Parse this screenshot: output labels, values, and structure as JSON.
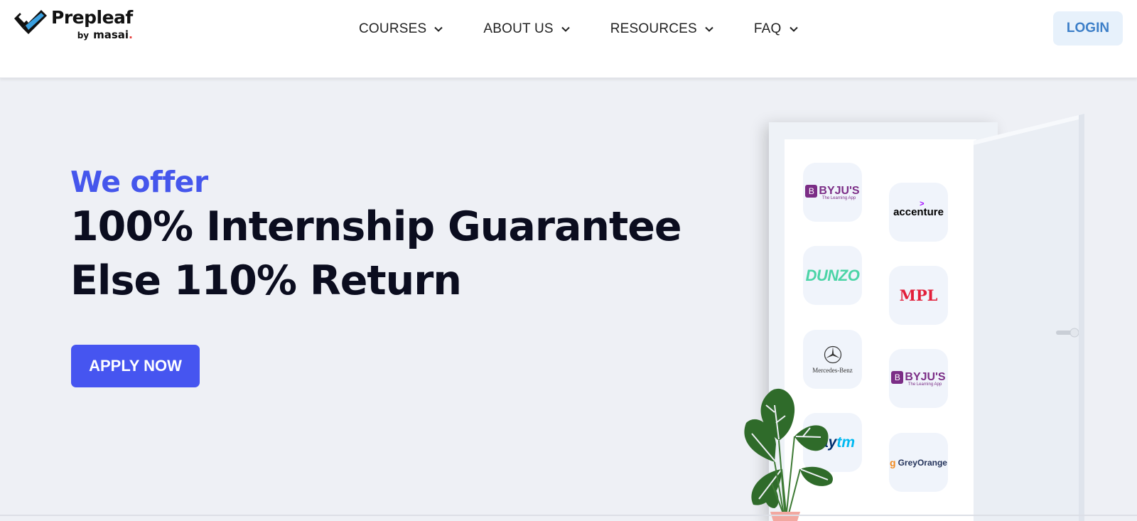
{
  "brand": {
    "name": "Prepleaf",
    "by": "by",
    "parent": "masai",
    "parent_dot": "."
  },
  "nav": {
    "items": [
      {
        "label": "COURSES",
        "icon": "chevron-down-icon"
      },
      {
        "label": "ABOUT US",
        "icon": "chevron-down-icon"
      },
      {
        "label": "RESOURCES",
        "icon": "chevron-down-icon"
      },
      {
        "label": "FAQ",
        "icon": "chevron-down-icon"
      }
    ],
    "login_label": "LOGIN"
  },
  "hero": {
    "offer": "We offer",
    "line1": "100% Internship Guarantee",
    "line2": "Else 110% Return",
    "cta": "APPLY NOW"
  },
  "partners": {
    "byjus_1": {
      "name": "BYJU'S",
      "tagline": "The Learning App",
      "mark": "B"
    },
    "accenture": {
      "name": "accenture",
      "mark": ">"
    },
    "dunzo": {
      "name": "DUNZO"
    },
    "mpl": {
      "name": "MPL"
    },
    "mercedes": {
      "name": "Mercedes-Benz"
    },
    "byjus_2": {
      "name": "BYJU'S",
      "tagline": "The Learning App",
      "mark": "B"
    },
    "paytm": {
      "pay": "Pay",
      "tm": "tm"
    },
    "greyorange": {
      "name": "GreyOrange",
      "mark": "g"
    }
  },
  "colors": {
    "accent": "#4655f0",
    "offer_text": "#4556ec",
    "login_bg": "#e7f1fb",
    "login_text": "#3d7fc8",
    "hero_bg": "#eef0f5"
  }
}
